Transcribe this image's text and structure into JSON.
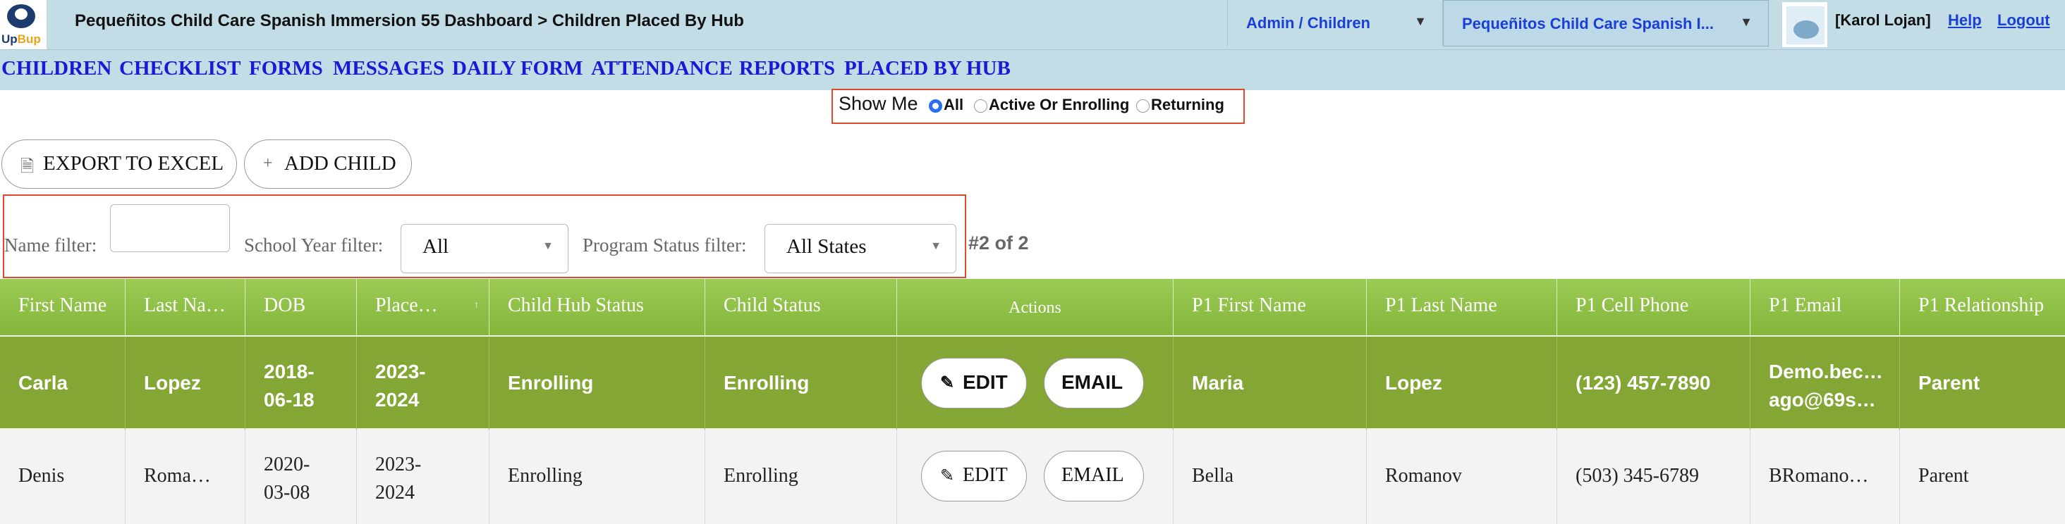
{
  "app": {
    "logo_text_a": "Up",
    "logo_text_b": "Bup",
    "breadcrumb": "Pequeñitos Child Care Spanish Immersion 55 Dashboard > Children Placed By Hub",
    "role_select": "Admin / Children",
    "center_select": "Pequeñitos Child Care Spanish I...",
    "user": "[Karol Lojan]",
    "help": "Help",
    "logout": "Logout"
  },
  "nav": [
    "CHILDREN",
    "CHECKLIST",
    "FORMS",
    "MESSAGES",
    "DAILY FORM",
    "ATTENDANCE",
    "REPORTS",
    "PLACED BY HUB"
  ],
  "showme": {
    "label": "Show Me",
    "options": [
      {
        "label": "All",
        "selected": true
      },
      {
        "label": "Active Or Enrolling",
        "selected": false
      },
      {
        "label": "Returning",
        "selected": false
      }
    ]
  },
  "toolbar": {
    "export_label": "EXPORT TO EXCEL",
    "add_label": "ADD CHILD",
    "add_icon": "+"
  },
  "filters": {
    "name_label": "Name filter:",
    "name_value": "",
    "year_label": "School Year filter:",
    "year_value": "All",
    "status_label": "Program Status filter:",
    "status_value": "All States",
    "count": "#2 of 2"
  },
  "table": {
    "headers": [
      "First Name",
      "Last Na…",
      "DOB",
      "Place…",
      "Child Hub Status",
      "Child Status",
      "Actions",
      "P1 First Name",
      "P1 Last Name",
      "P1 Cell Phone",
      "P1 Email",
      "P1 Relationship"
    ],
    "edit_label": "EDIT",
    "email_label": "EMAIL",
    "rows": [
      {
        "first": "Carla",
        "last": "Lopez",
        "dob_a": "2018-",
        "dob_b": "06-18",
        "place_a": "2023-",
        "place_b": "2024",
        "hub_status": "Enrolling",
        "child_status": "Enrolling",
        "p1_first": "Maria",
        "p1_last": "Lopez",
        "p1_phone": "(123) 457-7890",
        "p1_email_a": "Demo.bec…",
        "p1_email_b": "ago@69s…",
        "p1_rel": "Parent"
      },
      {
        "first": "Denis",
        "last": "Roma…",
        "dob_a": "2020-",
        "dob_b": "03-08",
        "place_a": "2023-",
        "place_b": "2024",
        "hub_status": "Enrolling",
        "child_status": "Enrolling",
        "p1_first": "Bella",
        "p1_last": "Romanov",
        "p1_phone": "(503) 345-6789",
        "p1_email": "BRomano…",
        "p1_rel": "Parent"
      }
    ]
  },
  "colors": {
    "header_bar": "#c3dde7",
    "nav_link": "#1a1ad6",
    "highlight_box": "#e0492d",
    "table_header": "#8fbf45",
    "selected_row": "#83a634"
  }
}
